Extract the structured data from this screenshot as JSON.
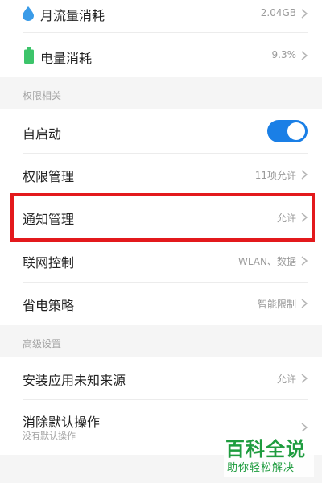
{
  "usage": {
    "data": {
      "label": "月流量消耗",
      "value": "2.04GB",
      "icon": "water-drop-icon"
    },
    "battery": {
      "label": "电量消耗",
      "value": "9.3%",
      "icon": "battery-icon"
    }
  },
  "permissions": {
    "section_title": "权限相关",
    "autostart": {
      "label": "自启动",
      "enabled": true
    },
    "permission_manage": {
      "label": "权限管理",
      "value": "11项允许"
    },
    "notification_manage": {
      "label": "通知管理",
      "value": "允许"
    },
    "network_control": {
      "label": "联网控制",
      "value": "WLAN、数据"
    },
    "power_strategy": {
      "label": "省电策略",
      "value": "智能限制"
    }
  },
  "advanced": {
    "section_title": "高级设置",
    "install_unknown": {
      "label": "安装应用未知来源",
      "value": "允许"
    },
    "clear_defaults": {
      "label": "消除默认操作",
      "sublabel": "没有默认操作"
    }
  },
  "watermark": {
    "title": "百科全说",
    "subtitle": "助你轻松解决"
  },
  "colors": {
    "accent": "#1a7fe6",
    "highlight": "#e3191c",
    "watermark": "#1f9c3f",
    "battery": "#3cc46a",
    "drop": "#3a9be8"
  }
}
